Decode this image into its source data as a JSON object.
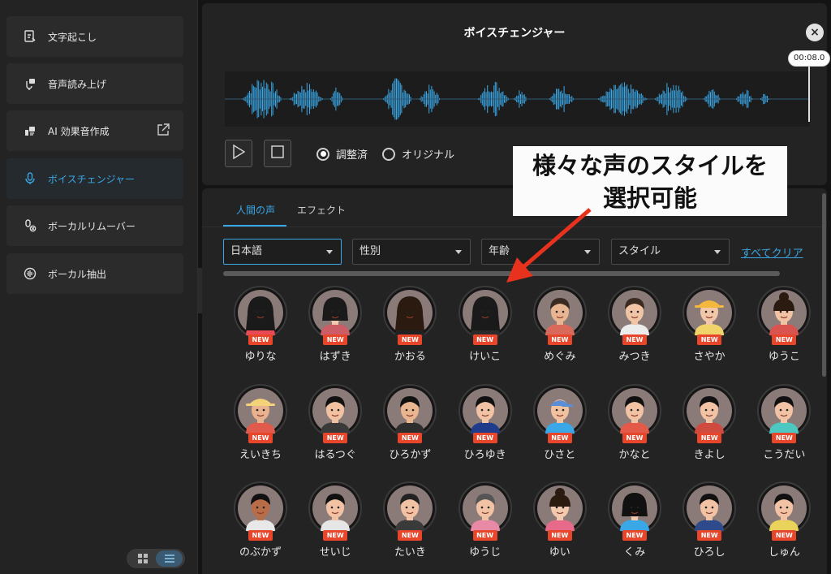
{
  "sidebar": {
    "items": [
      {
        "label": "文字起こし",
        "icon": "transcribe-icon",
        "active": false
      },
      {
        "label": "音声読み上げ",
        "icon": "text-to-speech-icon",
        "active": false
      },
      {
        "label": "AI 効果音作成",
        "icon": "ai-sound-effect-icon",
        "active": false,
        "external": true
      },
      {
        "label": "ボイスチェンジャー",
        "icon": "microphone-icon",
        "active": true
      },
      {
        "label": "ボーカルリムーバー",
        "icon": "vocal-remover-icon",
        "active": false
      },
      {
        "label": "ボーカル抽出",
        "icon": "vocal-extract-icon",
        "active": false
      }
    ],
    "view_toggle": [
      "grid-view-icon",
      "list-view-icon"
    ]
  },
  "header": {
    "title": "ボイスチェンジャー",
    "close_icon": "close-icon"
  },
  "player": {
    "time": "00:08.0",
    "play_icon": "play-icon",
    "stop_icon": "stop-icon",
    "modes": [
      {
        "label": "調整済",
        "selected": true
      },
      {
        "label": "オリジナル",
        "selected": false
      }
    ],
    "waveform_color": "#3aa7e6"
  },
  "annotation": {
    "line1": "様々な声のスタイルを",
    "line2": "選択可能",
    "arrow_color": "#e8321e"
  },
  "voices_panel": {
    "tabs": [
      {
        "label": "人間の声",
        "active": true
      },
      {
        "label": "エフェクト",
        "active": false
      }
    ],
    "filters": [
      {
        "label": "日本語",
        "active": true
      },
      {
        "label": "性別",
        "active": false
      },
      {
        "label": "年齢",
        "active": false
      },
      {
        "label": "スタイル",
        "active": false
      }
    ],
    "clear_all": "すべてクリア",
    "badge": "NEW",
    "voices": [
      {
        "name": "ゆりな",
        "skin": "#f2c4a6",
        "hair": "#1a1a1a",
        "shirt": "#e94a55",
        "style": "long"
      },
      {
        "name": "はずき",
        "skin": "#f3c9ae",
        "hair": "#1a1a1a",
        "shirt": "#cc5d66",
        "style": "bob"
      },
      {
        "name": "かおる",
        "skin": "#f1c3a4",
        "hair": "#2a1a10",
        "shirt": "#222222",
        "style": "long"
      },
      {
        "name": "けいこ",
        "skin": "#f1c1a1",
        "hair": "#1a1a1a",
        "shirt": "#2b2b2b",
        "style": "long"
      },
      {
        "name": "めぐみ",
        "skin": "#e8b592",
        "hair": "#3a2a22",
        "shirt": "#d96a5b",
        "style": "short"
      },
      {
        "name": "みつき",
        "skin": "#f0c4a5",
        "hair": "#3b2a20",
        "shirt": "#ececec",
        "style": "short"
      },
      {
        "name": "さやか",
        "skin": "#f2c6a8",
        "hair": "#f4b83f",
        "shirt": "#f0d46a",
        "style": "hat"
      },
      {
        "name": "ゆうこ",
        "skin": "#f1c3a4",
        "hair": "#2a1a10",
        "shirt": "#d9534f",
        "style": "bun"
      },
      {
        "name": "えいきち",
        "skin": "#e9b28e",
        "hair": "#f4d27a",
        "shirt": "#e05b4b",
        "style": "hat"
      },
      {
        "name": "はるつぐ",
        "skin": "#f1c2a2",
        "hair": "#111111",
        "shirt": "#3a3a3a",
        "style": "short"
      },
      {
        "name": "ひろかず",
        "skin": "#e9b690",
        "hair": "#111111",
        "shirt": "#2e2e2e",
        "style": "short"
      },
      {
        "name": "ひろゆき",
        "skin": "#f1c3a4",
        "hair": "#111111",
        "shirt": "#1f3b8a",
        "style": "short"
      },
      {
        "name": "ひさと",
        "skin": "#f0c2a0",
        "hair": "#5a8ed6",
        "shirt": "#3aa7e6",
        "style": "cap"
      },
      {
        "name": "かなと",
        "skin": "#f1c3a4",
        "hair": "#111111",
        "shirt": "#e45a48",
        "style": "short"
      },
      {
        "name": "きよし",
        "skin": "#f1c3a4",
        "hair": "#111111",
        "shirt": "#cf4b3f",
        "style": "short"
      },
      {
        "name": "こうだい",
        "skin": "#f1c3a4",
        "hair": "#111111",
        "shirt": "#4cc7c1",
        "style": "short"
      },
      {
        "name": "のぶかず",
        "skin": "#b86d48",
        "hair": "#111111",
        "shirt": "#e8e8e8",
        "style": "short"
      },
      {
        "name": "せいじ",
        "skin": "#f1c3a4",
        "hair": "#111111",
        "shirt": "#e6e6e6",
        "style": "short"
      },
      {
        "name": "たいき",
        "skin": "#f1c3a4",
        "hair": "#222222",
        "shirt": "#3a3a3a",
        "style": "short"
      },
      {
        "name": "ゆうじ",
        "skin": "#f1c3a4",
        "hair": "#555555",
        "shirt": "#e88aa6",
        "style": "short"
      },
      {
        "name": "ゆい",
        "skin": "#f3c9ae",
        "hair": "#2a1a10",
        "shirt": "#e86a8a",
        "style": "bun"
      },
      {
        "name": "くみ",
        "skin": "#f3c9ae",
        "hair": "#111111",
        "shirt": "#3aa7e6",
        "style": "bob"
      },
      {
        "name": "ひろし",
        "skin": "#f1c3a4",
        "hair": "#111111",
        "shirt": "#2e4a8a",
        "style": "short"
      },
      {
        "name": "しゅん",
        "skin": "#f1c3a4",
        "hair": "#111111",
        "shirt": "#e9d35a",
        "style": "short"
      }
    ]
  }
}
